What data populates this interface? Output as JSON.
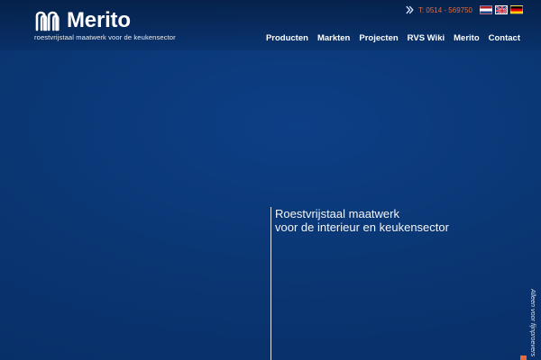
{
  "brand": {
    "name": "Merito",
    "tagline": "roestvrijstaal maatwerk voor de keukensector",
    "logo_icon": "merito-logo-mark"
  },
  "topbar": {
    "phone": "T: 0514 - 569750",
    "phone_icon": "double-chevron-right-icon",
    "languages": [
      {
        "code": "nl",
        "icon": "flag-nl-icon"
      },
      {
        "code": "en",
        "icon": "flag-uk-icon"
      },
      {
        "code": "de",
        "icon": "flag-de-icon"
      }
    ]
  },
  "nav": {
    "items": [
      "Producten",
      "Markten",
      "Projecten",
      "RVS Wiki",
      "Merito",
      "Contact"
    ]
  },
  "hero": {
    "line1": "Roestvrijstaal maatwerk",
    "line2": "voor de interieur en keukensector"
  },
  "side_badge": {
    "text": "Alleen voor fijnproevers"
  },
  "colors": {
    "background": "#0b3a7a",
    "accent": "#e36b3d",
    "text": "#ffffff"
  }
}
